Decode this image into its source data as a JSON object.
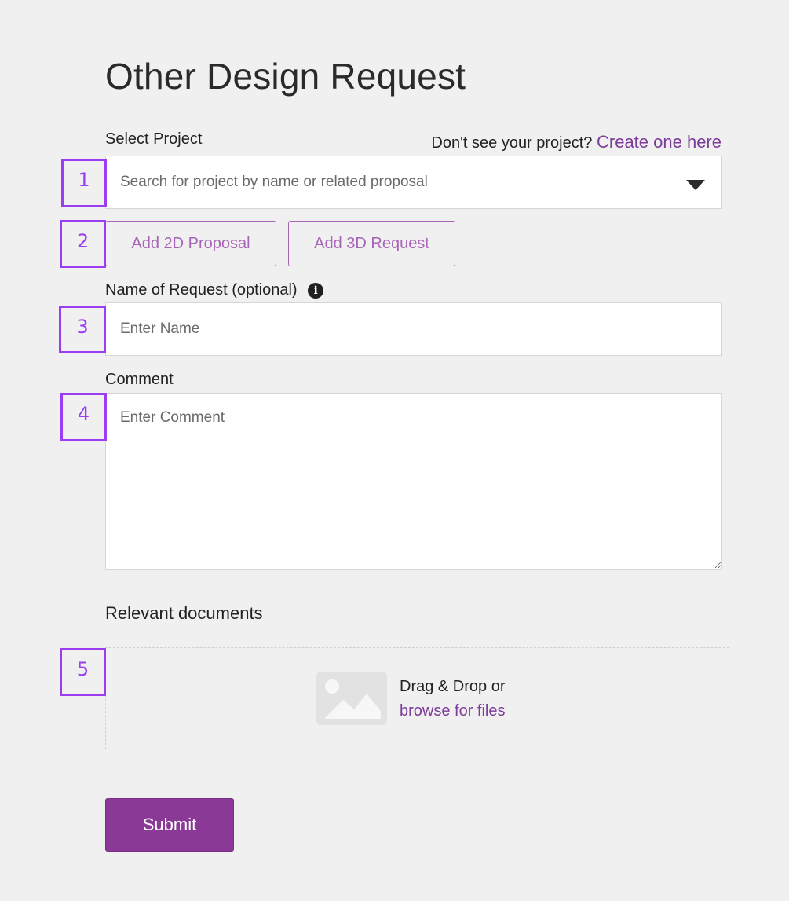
{
  "page": {
    "title": "Other Design Request"
  },
  "select_project": {
    "label": "Select Project",
    "prompt_text": "Don't see your project?",
    "create_link": "Create one here",
    "placeholder": "Search for project by name or related proposal"
  },
  "actions": {
    "add_2d_label": "Add 2D Proposal",
    "add_3d_label": "Add 3D Request"
  },
  "name_field": {
    "label": "Name of Request (optional)",
    "info_glyph": "i",
    "placeholder": "Enter Name",
    "value": ""
  },
  "comment_field": {
    "label": "Comment",
    "placeholder": "Enter Comment",
    "value": ""
  },
  "documents": {
    "title": "Relevant documents",
    "drop_text": "Drag & Drop or",
    "browse_link": "browse for files"
  },
  "submit": {
    "label": "Submit"
  },
  "markers": [
    "1",
    "2",
    "3",
    "4",
    "5"
  ],
  "colors": {
    "accent": "#8a3a96",
    "link": "#7d3c98",
    "outline_button": "#a865b8",
    "marker": "#9b3df0",
    "background": "#f0f0f0"
  },
  "icons": {
    "dropdown": "caret-down-icon",
    "info": "info-icon",
    "upload": "image-icon"
  }
}
